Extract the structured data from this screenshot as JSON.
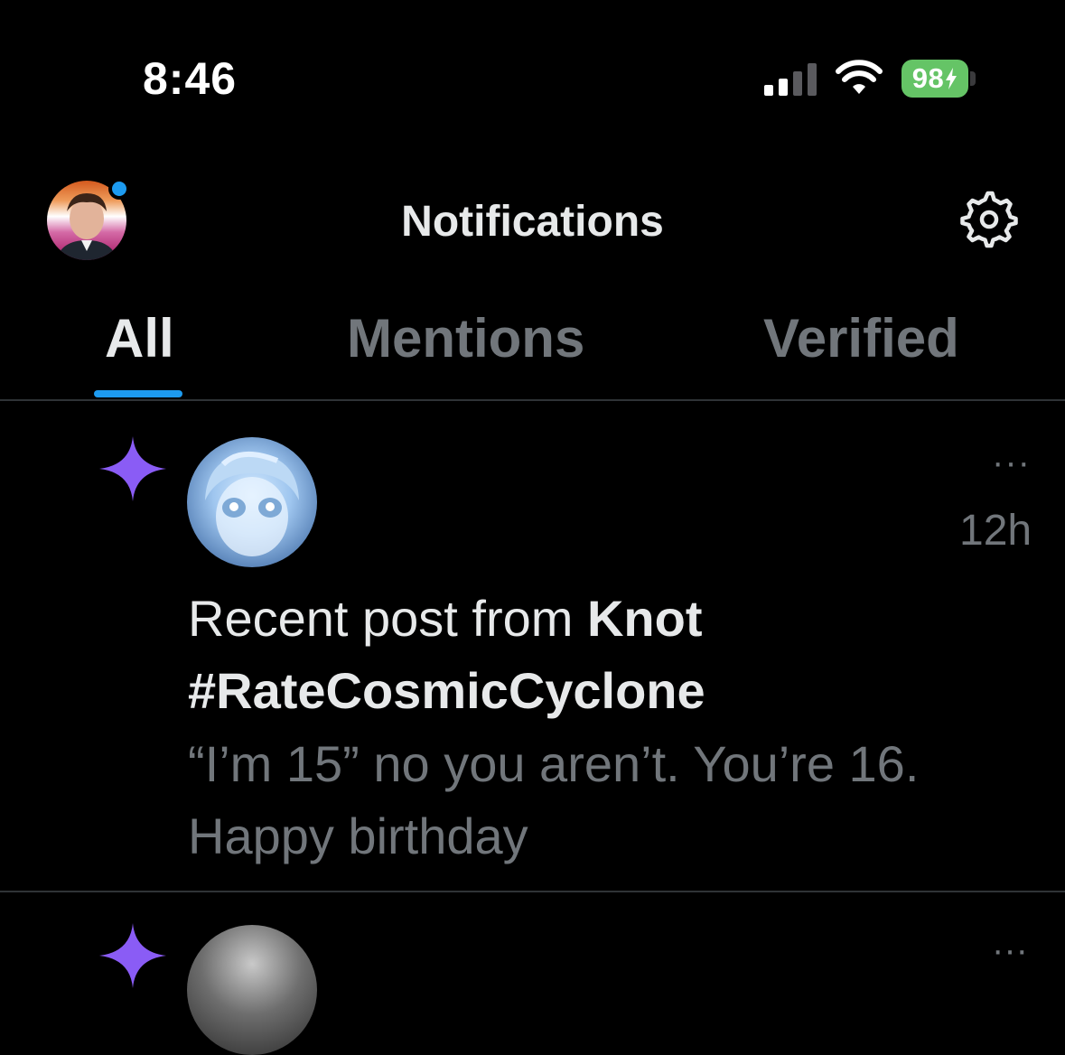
{
  "status_bar": {
    "time": "8:46",
    "battery": "98"
  },
  "header": {
    "title": "Notifications"
  },
  "tabs": [
    {
      "label": "All",
      "active": true
    },
    {
      "label": "Mentions",
      "active": false
    },
    {
      "label": "Verified",
      "active": false
    }
  ],
  "notification": {
    "time_ago": "12h",
    "more": "···",
    "prefix": "Recent post from ",
    "author": "Knot",
    "hashtag": "#RateCosmicCyclone",
    "body_line1": "“I’m 15” no you aren’t. You’re 16.",
    "body_line2": "Happy birthday"
  },
  "colors": {
    "accent": "#1d9bf0",
    "spark": "#8a5cf5",
    "secondary_text": "#71767b"
  }
}
